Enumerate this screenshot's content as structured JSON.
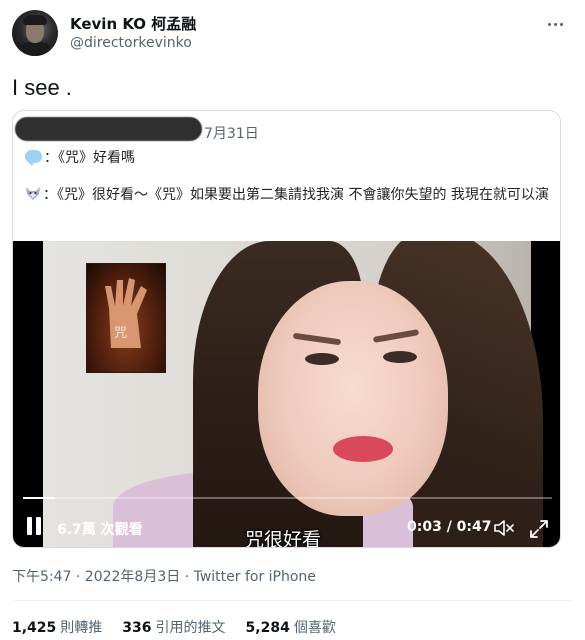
{
  "author": {
    "name": "Kevin KO 柯孟融",
    "handle": "@directorkevinko"
  },
  "tweet": {
    "text": "I see ."
  },
  "quoted": {
    "date": "7月31日",
    "line1": "：《咒》好看嗎",
    "line2": "：《咒》很好看～《咒》如果要出第二集請找我演 不會讓你失望的 我現在就可以演",
    "icons": [
      "speech-bubble-emoji",
      "wolf-emoji"
    ]
  },
  "video": {
    "poster_text": "咒",
    "views_label": "6.7萬 次觀看",
    "subtitle": "咒很好看",
    "time": "0:03 / 0:47",
    "progress": 0.06
  },
  "meta": {
    "timestamp": "下午5:47 · 2022年8月3日 · Twitter for iPhone"
  },
  "stats": [
    {
      "count": "1,425",
      "label": "則轉推"
    },
    {
      "count": "336",
      "label": "引用的推文"
    },
    {
      "count": "5,284",
      "label": "個喜歡"
    }
  ],
  "colors": {
    "text_primary": "#0f1419",
    "text_secondary": "#536471",
    "lips": "#d9485b"
  }
}
